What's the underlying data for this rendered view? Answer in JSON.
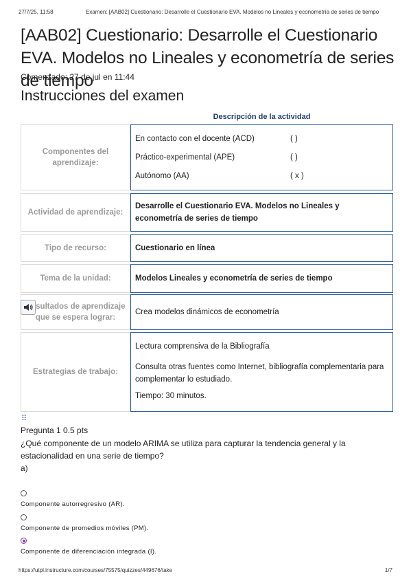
{
  "print_header": {
    "timestamp": "27/7/25, 11:58",
    "title": "Examen: [AAB02] Cuestionario: Desarrolle el Cuestionario EVA. Modelos no Lineales y econometría de series de tiempo"
  },
  "quiz": {
    "title": "[AAB02] Cuestionario: Desarrolle el Cuestionario EVA. Modelos no Lineales y econometría de series de tiempo",
    "started": "Comenzado: 27 de jul en 11:44"
  },
  "instructions": {
    "heading": "Instrucciones del examen",
    "table_caption": "Descripción de la actividad",
    "rows": {
      "components": {
        "label": "Componentes del aprendizaje:",
        "items": [
          {
            "name": "En contacto con el docente (ACD)",
            "mark": "(     )"
          },
          {
            "name": "Práctico-experimental (APE)",
            "mark": "(     )"
          },
          {
            "name": "Autónomo (AA)",
            "mark": "( x )"
          }
        ]
      },
      "activity": {
        "label": "Actividad de aprendizaje:",
        "value": "Desarrolle el Cuestionario EVA. Modelos no Lineales y econometría de series de tiempo"
      },
      "resource": {
        "label": "Tipo de recurso:",
        "value": "Cuestionario en línea"
      },
      "topic": {
        "label": "Tema de la unidad:",
        "value": "Modelos Lineales y econometría de series de tiempo"
      },
      "outcomes": {
        "label": "Resultados de aprendizaje que se espera lograr:",
        "value": "Crea modelos dinámicos de econometría"
      },
      "strategies": {
        "label": "Estrategias de trabajo:",
        "lines": [
          "Lectura comprensiva de la Bibliografía",
          "Consulta otras fuentes como Internet, bibliografía complementaria para complementar lo estudiado.",
          "Tiempo: 30 minutos."
        ]
      }
    }
  },
  "question": {
    "handle": "⠿",
    "header": "Pregunta 1 0.5 pts",
    "text": "¿Qué componente de un modelo ARIMA se utiliza para capturar la tendencia general y la estacionalidad en una serie de tiempo?",
    "sub": "a)",
    "options": [
      {
        "label": "Componente autorregresivo (AR).",
        "selected": false
      },
      {
        "label": "Componente de promedios móviles (PM).",
        "selected": false
      },
      {
        "label": "Componente de diferenciación integrada (I).",
        "selected": true
      }
    ]
  },
  "print_footer": {
    "url": "https://utpl.instructure.com/courses/75575/quizzes/449676/take",
    "page": "1/7"
  },
  "icons": {
    "speaker": "speaker-icon",
    "drag": "drag-handle-icon"
  },
  "colors": {
    "table_border": "#2f5f9e",
    "caption": "#1f3c6e",
    "radio_selected": "#8a3ea8"
  }
}
